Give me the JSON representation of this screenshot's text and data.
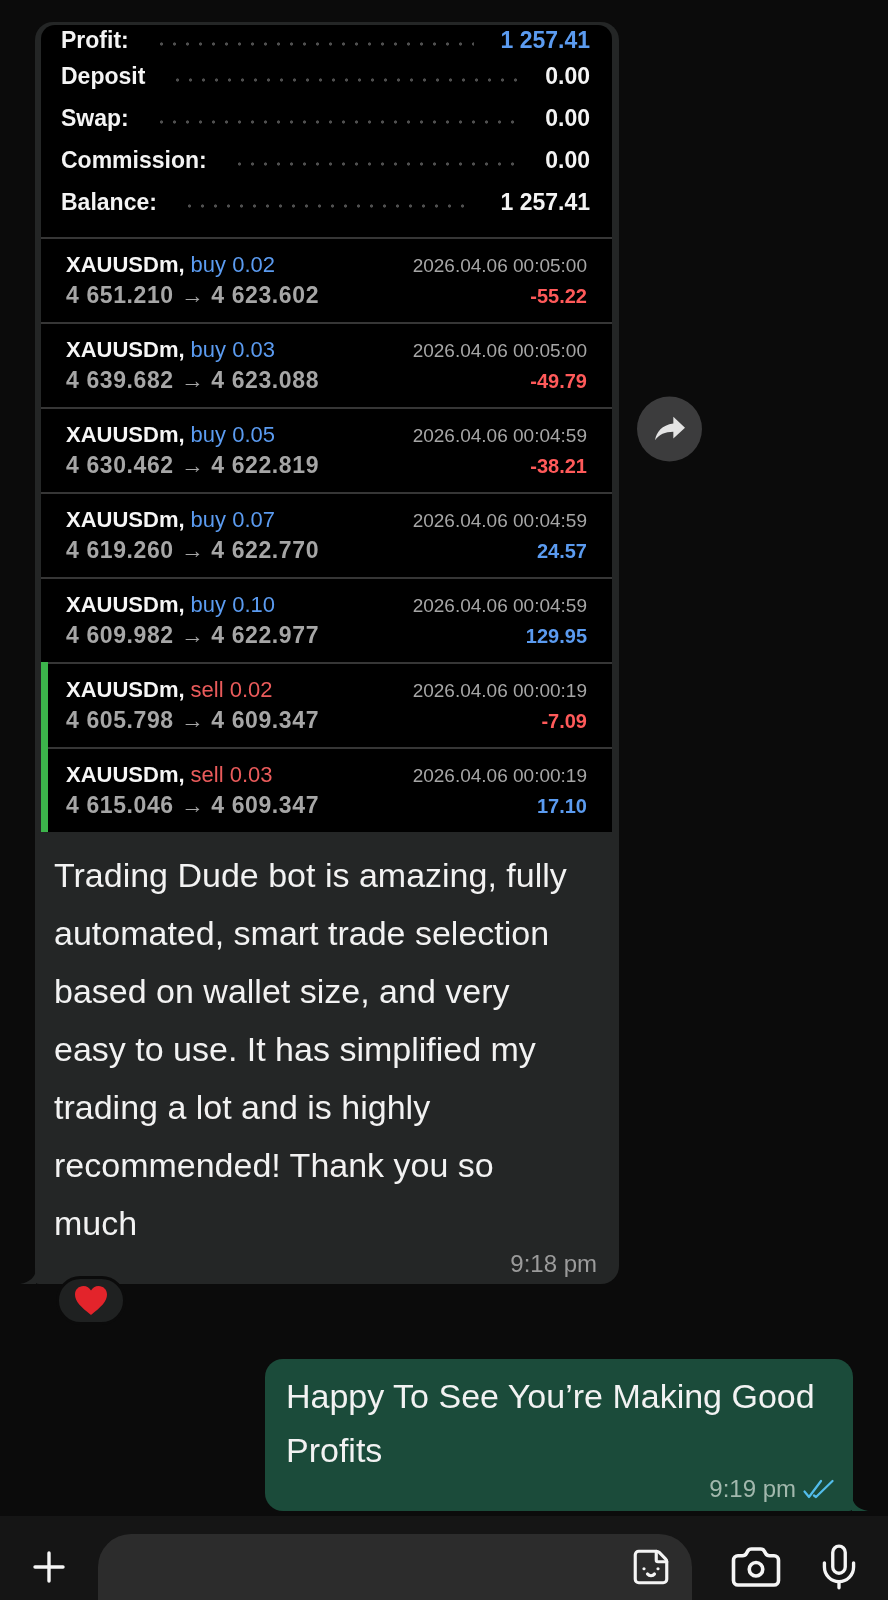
{
  "incoming_message": {
    "screenshot": {
      "summary": [
        {
          "label": "Profit:",
          "value": "1 257.41",
          "kind": "profit"
        },
        {
          "label": "Deposit",
          "value": "0.00",
          "kind": "amount"
        },
        {
          "label": "Swap:",
          "value": "0.00",
          "kind": "amount"
        },
        {
          "label": "Commission:",
          "value": "0.00",
          "kind": "amount"
        },
        {
          "label": "Balance:",
          "value": "1 257.41",
          "kind": "amount"
        }
      ],
      "trades": [
        {
          "symbol": "XAUUSDm,",
          "order": {
            "text": "buy 0.02",
            "kind": "buy"
          },
          "time": "2026.04.06 00:05:00",
          "prices": "4 651.210 → 4 623.602",
          "profit": {
            "text": "-55.22",
            "kind": "loss"
          },
          "highlighted": false
        },
        {
          "symbol": "XAUUSDm,",
          "order": {
            "text": "buy 0.03",
            "kind": "buy"
          },
          "time": "2026.04.06 00:05:00",
          "prices": "4 639.682 → 4 623.088",
          "profit": {
            "text": "-49.79",
            "kind": "loss"
          },
          "highlighted": false
        },
        {
          "symbol": "XAUUSDm,",
          "order": {
            "text": "buy 0.05",
            "kind": "buy"
          },
          "time": "2026.04.06 00:04:59",
          "prices": "4 630.462 → 4 622.819",
          "profit": {
            "text": "-38.21",
            "kind": "loss"
          },
          "highlighted": false
        },
        {
          "symbol": "XAUUSDm,",
          "order": {
            "text": "buy 0.07",
            "kind": "buy"
          },
          "time": "2026.04.06 00:04:59",
          "prices": "4 619.260 → 4 622.770",
          "profit": {
            "text": "24.57",
            "kind": "gain"
          },
          "highlighted": false
        },
        {
          "symbol": "XAUUSDm,",
          "order": {
            "text": "buy 0.10",
            "kind": "buy"
          },
          "time": "2026.04.06 00:04:59",
          "prices": "4 609.982 → 4 622.977",
          "profit": {
            "text": "129.95",
            "kind": "gain"
          },
          "highlighted": false
        },
        {
          "symbol": "XAUUSDm,",
          "order": {
            "text": "sell 0.02",
            "kind": "sell"
          },
          "time": "2026.04.06 00:00:19",
          "prices": "4 605.798 → 4 609.347",
          "profit": {
            "text": "-7.09",
            "kind": "loss"
          },
          "highlighted": true
        },
        {
          "symbol": "XAUUSDm,",
          "order": {
            "text": "sell 0.03",
            "kind": "sell"
          },
          "time": "2026.04.06 00:00:19",
          "prices": "4 615.046 → 4 609.347",
          "profit": {
            "text": "17.10",
            "kind": "gain"
          },
          "highlighted": true
        }
      ]
    },
    "text": "Trading Dude bot is amazing, fully automated, smart trade selection based on wallet size, and very easy to use. It has simplified my trading a lot and is highly recommended! Thank you so much",
    "time": "9:18 pm",
    "reaction": {
      "kind": "heart"
    }
  },
  "outgoing_message": {
    "text": "Happy To See You’re Making Good Profits",
    "time": "9:19 pm",
    "read": true
  }
}
